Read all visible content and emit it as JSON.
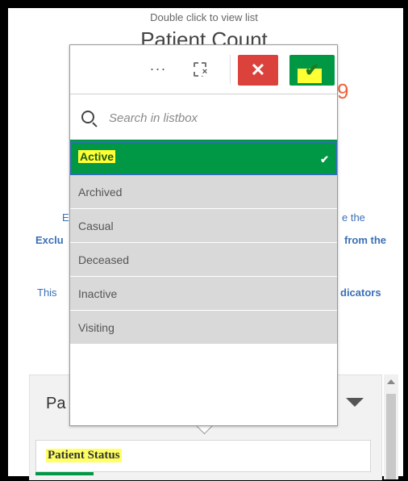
{
  "background": {
    "hint": "Double click to view list",
    "title": "Patient Count",
    "orange_char": "9",
    "text_lines": [
      {
        "text": "E",
        "bold": false
      },
      {
        "text": "e the",
        "bold": false
      },
      {
        "text": "Exclu",
        "bold": true
      },
      {
        "text": "from the",
        "bold": true
      },
      {
        "text": "This",
        "bold": false
      },
      {
        "text": "dicators",
        "bold": true
      }
    ],
    "panel_title": "Pa",
    "field_label": "Patient Status"
  },
  "listbox": {
    "toolbar": {
      "more_label": "···",
      "cancel_label": "✕",
      "confirm_label": "✔"
    },
    "search": {
      "placeholder": "Search in listbox",
      "value": ""
    },
    "items": [
      {
        "label": "Active",
        "selected": true,
        "check": "✔"
      },
      {
        "label": "Archived",
        "selected": false
      },
      {
        "label": "Casual",
        "selected": false
      },
      {
        "label": "Deceased",
        "selected": false
      },
      {
        "label": "Inactive",
        "selected": false
      },
      {
        "label": "Visiting",
        "selected": false
      }
    ]
  },
  "colors": {
    "selected_green": "#009845",
    "cancel_red": "#dc423c",
    "highlight_yellow": "#ffff33",
    "link_blue": "#3b6fb6",
    "accent_orange": "#f0643c"
  }
}
